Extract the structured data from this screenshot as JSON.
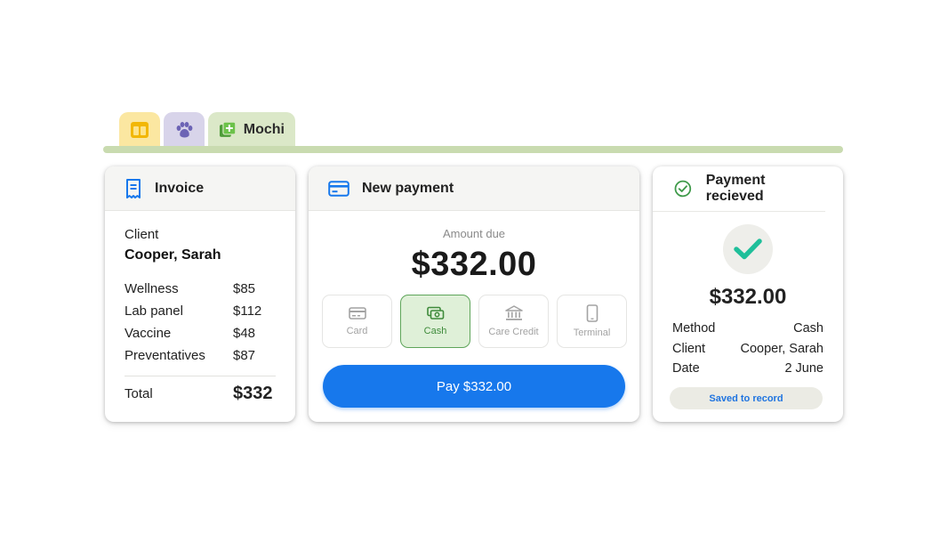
{
  "tabs": {
    "dashboard_icon": "dashboard-icon",
    "pet_icon": "paw-icon",
    "patient": {
      "icon": "add-record-icon",
      "label": "Mochi"
    }
  },
  "invoice": {
    "title": "Invoice",
    "icon": "receipt-icon",
    "client_label": "Client",
    "client_name": "Cooper, Sarah",
    "items": [
      {
        "name": "Wellness",
        "amount": "$85"
      },
      {
        "name": "Lab panel",
        "amount": "$112"
      },
      {
        "name": "Vaccine",
        "amount": "$48"
      },
      {
        "name": "Preventatives",
        "amount": "$87"
      }
    ],
    "total_label": "Total",
    "total_value": "$332"
  },
  "payment": {
    "title": "New payment",
    "icon": "credit-card-icon",
    "amount_label": "Amount due",
    "amount": "$332.00",
    "methods": [
      {
        "label": "Card",
        "icon": "card-icon",
        "selected": false
      },
      {
        "label": "Cash",
        "icon": "cash-icon",
        "selected": true
      },
      {
        "label": "Care Credit",
        "icon": "bank-icon",
        "selected": false
      },
      {
        "label": "Terminal",
        "icon": "phone-icon",
        "selected": false
      }
    ],
    "pay_button_label": "Pay $332.00"
  },
  "received": {
    "title": "Payment recieved",
    "icon": "check-circle-icon",
    "amount": "$332.00",
    "rows": [
      {
        "label": "Method",
        "value": "Cash"
      },
      {
        "label": "Client",
        "value": "Cooper, Sarah"
      },
      {
        "label": "Date",
        "value": "2 June"
      }
    ],
    "saved_badge": "Saved to record"
  },
  "colors": {
    "accent_blue": "#1778ec",
    "success_green": "#3f8b3b",
    "check_teal": "#1fbf9a",
    "tab_yellow": "#fbe7a1",
    "tab_purple": "#d8d4ea",
    "tab_green": "#dbe8c8"
  }
}
